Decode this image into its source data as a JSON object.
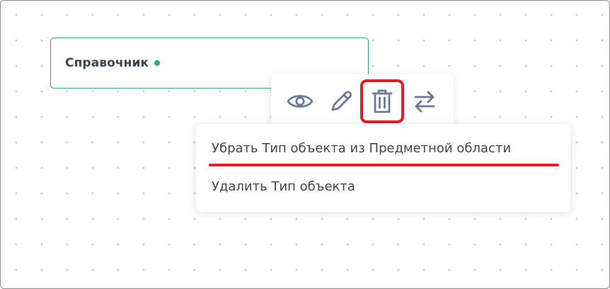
{
  "node": {
    "title": "Справочник",
    "status_color": "#1fb17a",
    "border_color": "#2ea87a"
  },
  "toolbar": {
    "tools": [
      {
        "icon": "eye-icon",
        "action": "view"
      },
      {
        "icon": "pencil-icon",
        "action": "edit"
      },
      {
        "icon": "trash-icon",
        "action": "delete",
        "highlighted": true
      },
      {
        "icon": "swap-arrows-icon",
        "action": "replace"
      }
    ],
    "icon_color": "#6b7a90",
    "highlight_color": "#e0202e"
  },
  "delete_menu": {
    "items": [
      {
        "label": "Убрать Тип объекта из Предметной области",
        "underlined": true
      },
      {
        "label": "Удалить Тип объекта"
      }
    ]
  }
}
